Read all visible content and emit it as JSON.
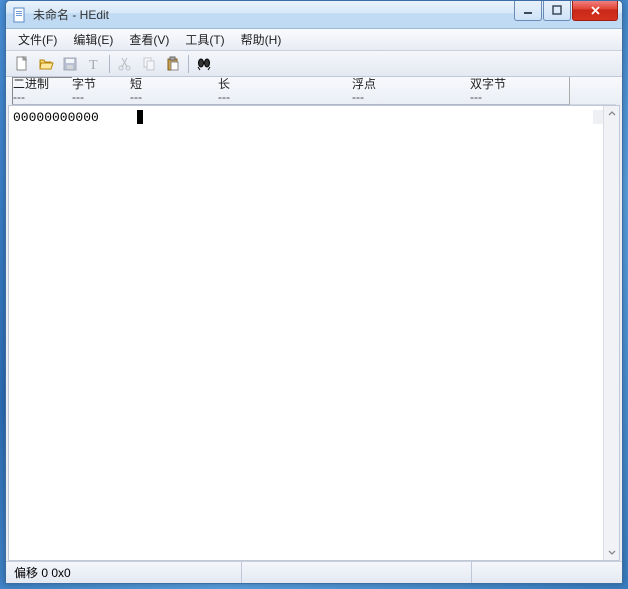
{
  "window": {
    "title": "未命名 - HEdit"
  },
  "menu": {
    "file": "文件(F)",
    "edit": "编辑(E)",
    "view": "查看(V)",
    "tools": "工具(T)",
    "help": "帮助(H)"
  },
  "header": {
    "binary": {
      "label": "二进制",
      "value": "---"
    },
    "byte": {
      "label": "字节",
      "value": "---"
    },
    "short": {
      "label": "短",
      "value": "---"
    },
    "long": {
      "label": "长",
      "value": "---"
    },
    "float": {
      "label": "浮点",
      "value": "---"
    },
    "dbyte": {
      "label": "双字节",
      "value": "---"
    }
  },
  "content": {
    "offset": "00000000000"
  },
  "status": {
    "offset": "偏移 0 0x0"
  },
  "icons": {
    "new": "new-file-icon",
    "open": "open-folder-icon",
    "save": "save-icon",
    "text": "text-icon",
    "cut": "cut-icon",
    "copy": "copy-icon",
    "paste": "paste-icon",
    "find": "find-icon"
  }
}
